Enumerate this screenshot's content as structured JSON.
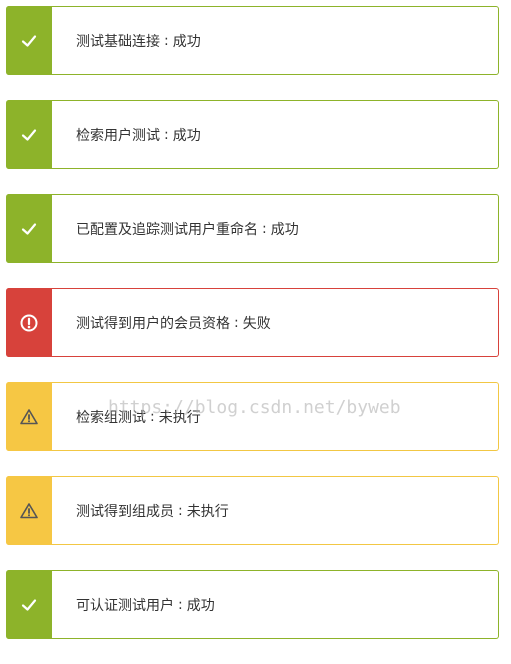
{
  "colors": {
    "success": "#8db32a",
    "warning": "#f6c744",
    "error": "#d7423b",
    "text": "#333333"
  },
  "separator": ":",
  "results": [
    {
      "test": "测试基础连接",
      "status": "成功",
      "state": "success",
      "icon": "check-icon"
    },
    {
      "test": "检索用户测试",
      "status": "成功",
      "state": "success",
      "icon": "check-icon"
    },
    {
      "test": "已配置及追踪测试用户重命名",
      "status": "成功",
      "state": "success",
      "icon": "check-icon"
    },
    {
      "test": "测试得到用户的会员资格",
      "status": "失败",
      "state": "error",
      "icon": "error-circle-icon"
    },
    {
      "test": "检索组测试",
      "status": "未执行",
      "state": "warning",
      "icon": "warning-triangle-icon"
    },
    {
      "test": "测试得到组成员",
      "status": "未执行",
      "state": "warning",
      "icon": "warning-triangle-icon"
    },
    {
      "test": "可认证测试用户",
      "status": "成功",
      "state": "success",
      "icon": "check-icon"
    }
  ],
  "watermark": "https://blog.csdn.net/byweb"
}
